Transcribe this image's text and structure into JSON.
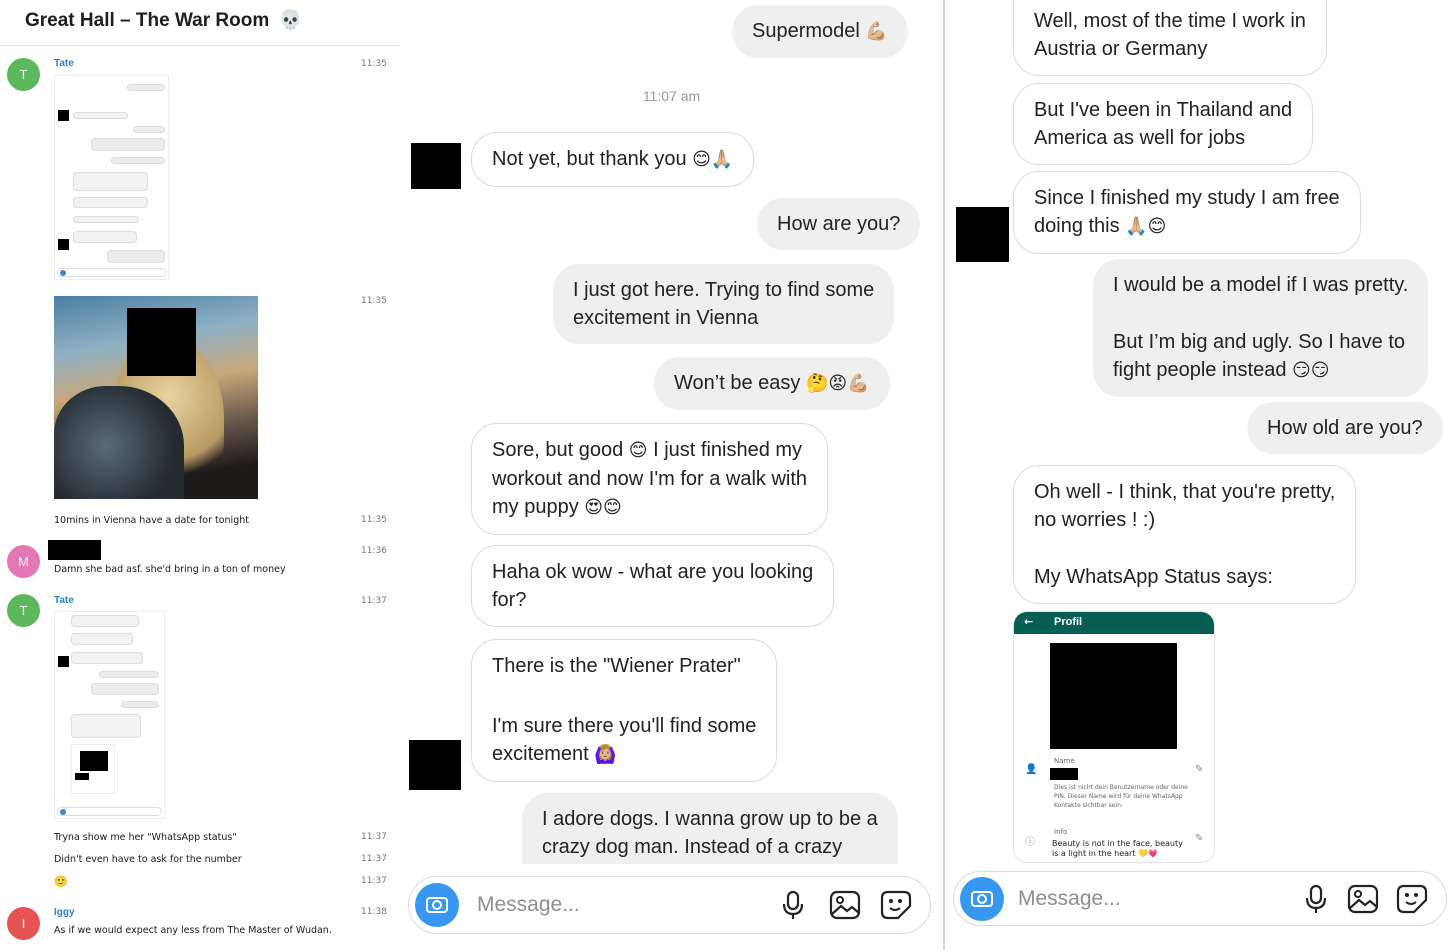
{
  "left": {
    "title": "Great Hall – The War Room",
    "title_icon": "💀",
    "messages": [
      {
        "author": "Tate",
        "avatar_letter": "T",
        "avatar_color": "#5cb85c",
        "time": "11:35"
      },
      {
        "time": "11:35"
      },
      {
        "text": "10mins in Vienna have a date for tonight",
        "time": "11:35"
      },
      {
        "avatar_letter": "M",
        "avatar_color": "#e377b3",
        "time": "11:36",
        "text": "Damn she bad asf. she'd bring in a ton of money"
      },
      {
        "author": "Tate",
        "avatar_letter": "T",
        "avatar_color": "#5cb85c",
        "time": "11:37"
      },
      {
        "text": "Tryna show me her \"WhatsApp status\"",
        "time": "11:37"
      },
      {
        "text": "Didn't even have to ask for the number",
        "time": "11:37"
      },
      {
        "text": "🙂",
        "time": "11:37"
      },
      {
        "author": "Iggy",
        "avatar_letter": "I",
        "avatar_color": "#e55353",
        "time": "11:38",
        "text": "As if we would expect any less from The Master of Wudan."
      }
    ]
  },
  "middle": {
    "timestamp": "11:07 am",
    "bubbles": [
      {
        "text": "Supermodel",
        "emoji": "💪🏼"
      },
      {
        "text": "Not yet, but thank you",
        "emoji": "😊🙏🏼"
      },
      {
        "text": "How are you?"
      },
      {
        "line1": "I just got here. Trying to find some",
        "line2": "excitement in Vienna"
      },
      {
        "text": "Won’t be easy",
        "emoji": "🤔😡💪🏼"
      },
      {
        "line1": "Sore, but good",
        "emoji1": "😊",
        "line1b": "I just finished my",
        "line2": "workout and now I'm for a walk with",
        "line3": "my puppy",
        "emoji3": "😍😊"
      },
      {
        "line1": "Haha ok wow - what are you looking",
        "line2": "for?"
      },
      {
        "line1": "There is the \"Wiener Prater\"",
        "line2": "I'm sure there you'll find some",
        "line3": "excitement",
        "emoji3": "🙆🏼‍♀️"
      },
      {
        "line1": "I adore dogs. I wanna grow up to be a",
        "line2": "crazy dog man. Instead of a crazy"
      }
    ],
    "message_placeholder": "Message..."
  },
  "right": {
    "bubbles": [
      {
        "line1": "Well, most of the time I work in",
        "line2": "Austria or Germany"
      },
      {
        "line1": "But I've been in Thailand and",
        "line2": "America as well for jobs"
      },
      {
        "line1": "Since I finished my study I am free",
        "line2": "doing this",
        "emoji2": "🙏🏼😊"
      },
      {
        "line1": "I would be a model if I was pretty.",
        "line2": "But I’m big and ugly. So I have to",
        "line3": "fight people instead",
        "emoji3": "😏😏"
      },
      {
        "text": "How old are you?"
      },
      {
        "line1": "Oh well - I think, that you're pretty,",
        "line2": "no worries ! :)",
        "line3": "My WhatsApp Status says:"
      }
    ],
    "whatsapp": {
      "header": "Profil",
      "name_label": "Name",
      "name_hint_1": "Dies ist nicht dein Benutzername oder deine",
      "name_hint_2": "PIN. Dieser Name wird für deine WhatsApp",
      "name_hint_3": "Kontakte sichtbar sein.",
      "info_label": "Info",
      "info_1": "Beauty is not in the face, beauty",
      "info_2": "is a light in the heart",
      "info_emoji": "💛💗"
    },
    "message_placeholder": "Message..."
  },
  "colors": {
    "accent_blue": "#3897f0",
    "whatsapp_green": "#075e54",
    "link_blue": "#2d7fd0"
  }
}
